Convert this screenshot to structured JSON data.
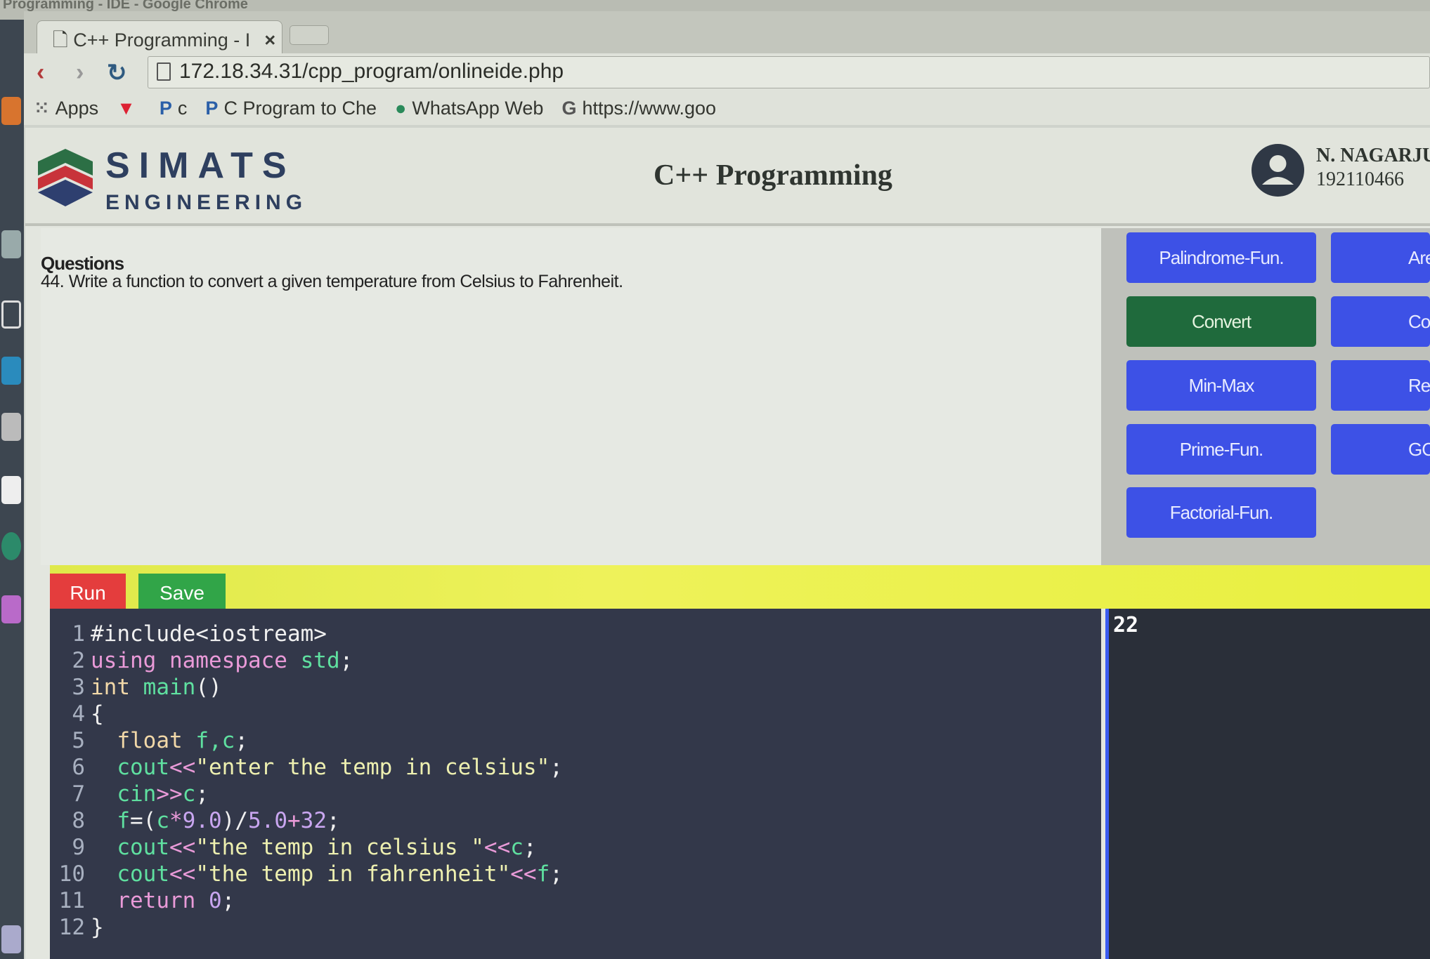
{
  "window": {
    "title": "Programming - IDE - Google Chrome"
  },
  "browser": {
    "tab_title": "C++ Programming - I",
    "tab_close": "×",
    "url": "172.18.34.31/cpp_program/onlineide.php",
    "bookmarks": [
      {
        "label": "Apps",
        "icon": "apps-grid-icon"
      },
      {
        "label": "",
        "icon": "tinder-icon"
      },
      {
        "label": "c",
        "icon": "p-icon"
      },
      {
        "label": "C Program to Che",
        "icon": "p-icon"
      },
      {
        "label": "WhatsApp Web",
        "icon": "whatsapp-icon"
      },
      {
        "label": "https://www.goo",
        "icon": "google-icon"
      }
    ]
  },
  "header": {
    "brand_line1": "SIMATS",
    "brand_line2": "ENGINEERING",
    "title": "C++ Programming",
    "user_name": "N. NAGARJU",
    "user_id": "192110466"
  },
  "question": {
    "heading": "Questions",
    "text": "44. Write a function to convert a given temperature from Celsius to Fahrenheit."
  },
  "programs": {
    "col1": [
      "Palindrome-Fun.",
      "Convert",
      "Min-Max",
      "Prime-Fun.",
      "Factorial-Fun."
    ],
    "col2": [
      "Are",
      "Cou",
      "Reve",
      "GCD-"
    ],
    "active": "Convert"
  },
  "actions": {
    "run": "Run",
    "save": "Save"
  },
  "code": [
    [
      {
        "t": "#include<iostream>",
        "c": "pl"
      }
    ],
    [
      {
        "t": "using namespace ",
        "c": "kw"
      },
      {
        "t": "std",
        "c": "fn"
      },
      {
        "t": ";",
        "c": "pl"
      }
    ],
    [
      {
        "t": "int ",
        "c": "ty"
      },
      {
        "t": "main",
        "c": "fn"
      },
      {
        "t": "()",
        "c": "pl"
      }
    ],
    [
      {
        "t": "{",
        "c": "pl"
      }
    ],
    [
      {
        "t": "  float ",
        "c": "ty"
      },
      {
        "t": "f,c",
        "c": "fn"
      },
      {
        "t": ";",
        "c": "pl"
      }
    ],
    [
      {
        "t": "  cout",
        "c": "fn"
      },
      {
        "t": "<<",
        "c": "kw"
      },
      {
        "t": "\"enter the temp in celsius\"",
        "c": "str"
      },
      {
        "t": ";",
        "c": "pl"
      }
    ],
    [
      {
        "t": "  cin",
        "c": "fn"
      },
      {
        "t": ">>",
        "c": "kw"
      },
      {
        "t": "c",
        "c": "fn"
      },
      {
        "t": ";",
        "c": "pl"
      }
    ],
    [
      {
        "t": "  f",
        "c": "fn"
      },
      {
        "t": "=(",
        "c": "pl"
      },
      {
        "t": "c",
        "c": "fn"
      },
      {
        "t": "*",
        "c": "kw"
      },
      {
        "t": "9.0",
        "c": "num"
      },
      {
        "t": ")/",
        "c": "pl"
      },
      {
        "t": "5.0",
        "c": "num"
      },
      {
        "t": "+",
        "c": "kw"
      },
      {
        "t": "32",
        "c": "num"
      },
      {
        "t": ";",
        "c": "pl"
      }
    ],
    [
      {
        "t": "  cout",
        "c": "fn"
      },
      {
        "t": "<<",
        "c": "kw"
      },
      {
        "t": "\"the temp in celsius \"",
        "c": "str"
      },
      {
        "t": "<<",
        "c": "kw"
      },
      {
        "t": "c",
        "c": "fn"
      },
      {
        "t": ";",
        "c": "pl"
      }
    ],
    [
      {
        "t": "  cout",
        "c": "fn"
      },
      {
        "t": "<<",
        "c": "kw"
      },
      {
        "t": "\"the temp in fahrenheit\"",
        "c": "str"
      },
      {
        "t": "<<",
        "c": "kw"
      },
      {
        "t": "f",
        "c": "fn"
      },
      {
        "t": ";",
        "c": "pl"
      }
    ],
    [
      {
        "t": "  return ",
        "c": "kw"
      },
      {
        "t": "0",
        "c": "num"
      },
      {
        "t": ";",
        "c": "pl"
      }
    ],
    [
      {
        "t": "}",
        "c": "pl"
      }
    ]
  ],
  "output": {
    "text": "22"
  }
}
